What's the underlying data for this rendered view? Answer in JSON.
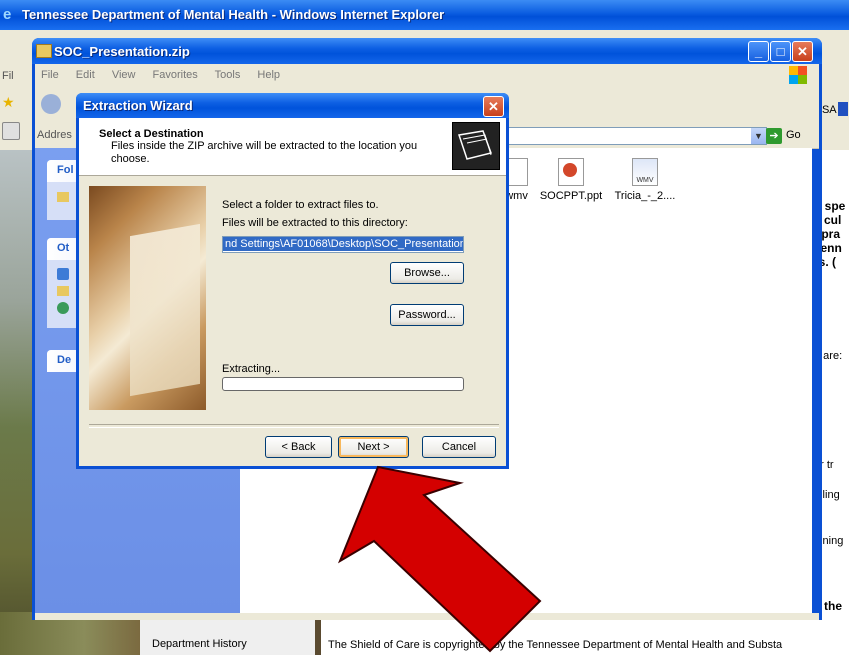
{
  "ie": {
    "title": "Tennessee Department of Mental Health - Windows Internet Explorer",
    "menu_fragment": "Fil",
    "fav_fragment": "HSA",
    "page_right_lines": [
      "d spe",
      "e cul",
      "t pra",
      "Tenn",
      "rs. (",
      "d are:",
      ")",
      "or tr",
      "ailing",
      "aining",
      "e the"
    ],
    "dept_history": "Department History",
    "copyright": "The Shield of Care is copyrighted by the Tennessee Department of Mental Health and Substa"
  },
  "zip_window": {
    "title": "SOC_Presentation.zip",
    "menu": [
      "File",
      "Edit",
      "View",
      "Favorites",
      "Tools",
      "Help"
    ],
    "address_label": "Addres",
    "go_label": "Go",
    "left_pane_labels": [
      "Fol",
      "Ot",
      "De"
    ],
    "files": [
      {
        "name": ".wmv",
        "icon": "video-file-icon"
      },
      {
        "name": "SOCPPT.ppt",
        "icon": "powerpoint-file-icon"
      },
      {
        "name": "Tricia_-_2....",
        "icon": "wmv-file-icon"
      }
    ],
    "wmv_badge": "WMV"
  },
  "wizard": {
    "title": "Extraction Wizard",
    "header_title": "Select a Destination",
    "header_subtitle": "Files inside the ZIP archive will be extracted to the location you choose.",
    "select_folder_text": "Select a folder to extract files to.",
    "dir_label": "Files will be extracted to this directory:",
    "dir_value": "nd Settings\\AF01068\\Desktop\\SOC_Presentation",
    "browse_label": "Browse...",
    "password_label": "Password...",
    "extracting_label": "Extracting...",
    "progress": 0,
    "back_label": "< Back",
    "next_label": "Next >",
    "cancel_label": "Cancel"
  },
  "colors": {
    "xp_blue": "#0a50d4",
    "arrow_red": "#d40000"
  }
}
